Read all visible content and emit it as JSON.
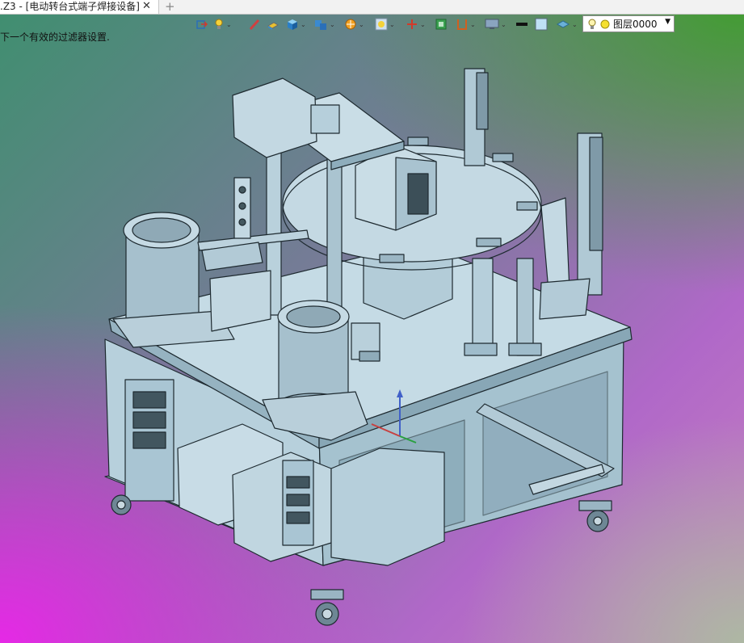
{
  "tab": {
    "title": ".Z3 - [电动转台式端子焊接设备]",
    "close_glyph": "✕",
    "add_glyph": "+"
  },
  "status": {
    "message": "下一个有效的过滤器设置."
  },
  "layer": {
    "name": "图层0000"
  },
  "toolbar": {
    "icons": [
      "insert-icon",
      "lightbulb-icon",
      "pen-icon",
      "face-icon",
      "solid-cube-icon",
      "multi-cube-icon",
      "render-icon",
      "zoom-icon",
      "axis-icon",
      "frame-icon",
      "bracket-icon",
      "monitor-icon",
      "line-color-icon",
      "fill-color-icon",
      "layer-stack-icon"
    ]
  },
  "colors": {
    "model_fill": "#b4cfdb",
    "model_shade": "#8fb0bf",
    "model_dark": "#6e8f9e",
    "edge": "#1e2a30"
  }
}
